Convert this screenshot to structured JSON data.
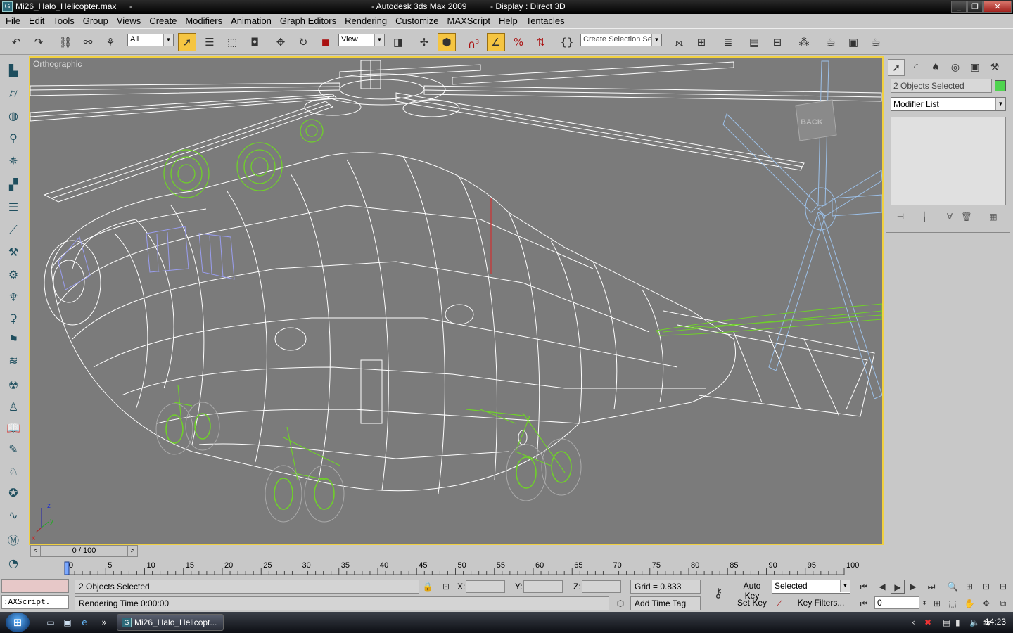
{
  "window": {
    "file_name": "Mi26_Halo_Helicopter.max",
    "file_sep": "-",
    "app_title": "- Autodesk 3ds Max  2009",
    "display": "- Display : Direct 3D",
    "app_icon": "3ds-max-icon"
  },
  "menu": [
    "File",
    "Edit",
    "Tools",
    "Group",
    "Views",
    "Create",
    "Modifiers",
    "Animation",
    "Graph Editors",
    "Rendering",
    "Customize",
    "MAXScript",
    "Help",
    "Tentacles"
  ],
  "toolbar": {
    "filter_value": "All",
    "refcoord_value": "View",
    "named_selection_placeholder": "Create Selection Set",
    "snap_label": "3"
  },
  "viewport": {
    "label": "Orthographic",
    "viewcube_label": "BACK",
    "axis_z": "z",
    "axis_x": "x",
    "axis_y": "y",
    "border_color": "#f0d040",
    "background": "#7b7b7b",
    "wire_color": "#ffffff",
    "selected_color": "#6fd02a"
  },
  "command_panel": {
    "object_name": "2 Objects Selected",
    "object_color": "#4fd44f",
    "modifier_list": "Modifier List"
  },
  "time_slider": {
    "position": "0 / 100",
    "start": 0,
    "end": 100
  },
  "trackbar": {
    "labels": [
      "0",
      "5",
      "10",
      "15",
      "20",
      "25",
      "30",
      "35",
      "40",
      "45",
      "50",
      "55",
      "60",
      "65",
      "70",
      "75",
      "80",
      "85",
      "90",
      "95",
      "100"
    ]
  },
  "status": {
    "maxscript_text": ":AXScript.",
    "selection_text": "2 Objects Selected",
    "prompt_text": "Rendering Time  0:00:00",
    "x_label": "X:",
    "y_label": "Y:",
    "z_label": "Z:",
    "grid_text": "Grid = 0.833'",
    "add_time_tag": "Add Time Tag",
    "auto_key": "Auto Key",
    "set_key": "Set Key",
    "key_mode_value": "Selected",
    "key_filters": "Key Filters...",
    "current_frame": "0"
  },
  "taskbar": {
    "task_label": "Mi26_Halo_Helicopt...",
    "clock": "14:23"
  }
}
